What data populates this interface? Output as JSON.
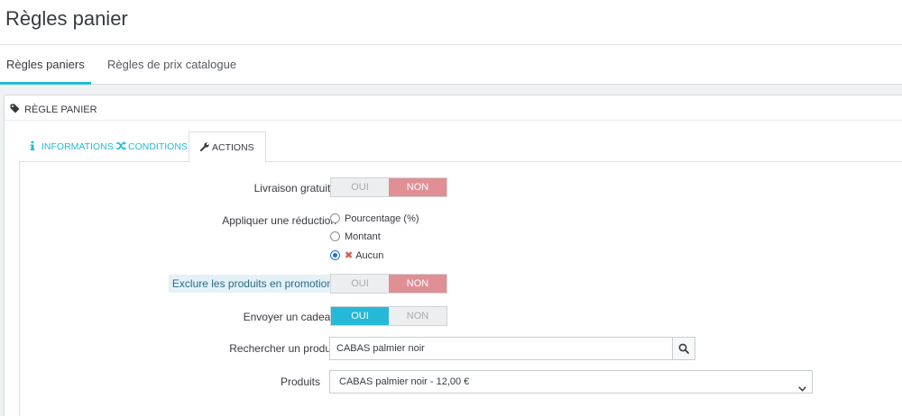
{
  "page": {
    "title": "Règles panier"
  },
  "top_tabs": [
    {
      "label": "Règles paniers",
      "active": true
    },
    {
      "label": "Règles de prix catalogue",
      "active": false
    }
  ],
  "panel": {
    "heading": "Règle panier"
  },
  "inner_tabs": [
    {
      "label": "Informations",
      "icon": "info-icon",
      "active": false
    },
    {
      "label": "Conditions",
      "icon": "shuffle-icon",
      "active": false
    },
    {
      "label": "Actions",
      "icon": "wrench-icon",
      "active": true
    }
  ],
  "form": {
    "free_shipping": {
      "label": "Livraison gratuite",
      "yes": "OUI",
      "no": "NON",
      "value": "NON"
    },
    "apply_discount": {
      "label": "Appliquer une réduction",
      "options": [
        "Pourcentage (%)",
        "Montant",
        "Aucun"
      ],
      "selected": "Aucun"
    },
    "exclude_promo": {
      "label": "Exclure les produits en promotion",
      "yes": "OUI",
      "no": "NON",
      "value": "NON"
    },
    "send_gift": {
      "label": "Envoyer un cadeau",
      "yes": "OUI",
      "no": "NON",
      "value": "OUI"
    },
    "search_product": {
      "label": "Rechercher un produit",
      "value": "CABAS palmier noir",
      "icon": "search-icon"
    },
    "products": {
      "label": "Produits",
      "selected": "CABAS palmier noir - 12,00 €"
    }
  },
  "colors": {
    "accent": "#25b9d7",
    "no_active": "#e08f95"
  }
}
